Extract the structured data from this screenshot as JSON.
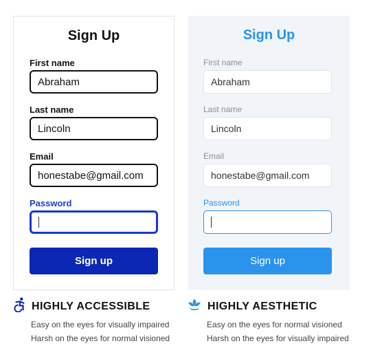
{
  "colors": {
    "accessible_accent": "#0b27b4",
    "accessible_focus": "#1e3cd8",
    "aesthetic_accent": "#2a93ec",
    "aesthetic_background": "#f1f5f9"
  },
  "accessible": {
    "title": "Sign Up",
    "first_name_label": "First name",
    "first_name_value": "Abraham",
    "last_name_label": "Last name",
    "last_name_value": "Lincoln",
    "email_label": "Email",
    "email_value": "honestabe@gmail.com",
    "password_label": "Password",
    "password_value": "",
    "submit_label": "Sign up",
    "icon": "accessibility-icon",
    "caption_title": "HIGHLY ACCESSIBLE",
    "caption_line1": "Easy on the eyes for visually impaired",
    "caption_line2": "Harsh on the eyes for normal visioned"
  },
  "aesthetic": {
    "title": "Sign Up",
    "first_name_label": "First name",
    "first_name_value": "Abraham",
    "last_name_label": "Last name",
    "last_name_value": "Lincoln",
    "email_label": "Email",
    "email_value": "honestabe@gmail.com",
    "password_label": "Password",
    "password_value": "",
    "submit_label": "Sign up",
    "icon": "lotus-icon",
    "caption_title": "HIGHLY AESTHETIC",
    "caption_line1": "Easy on the eyes for normal visioned",
    "caption_line2": "Harsh on the eyes for visually impaired"
  }
}
